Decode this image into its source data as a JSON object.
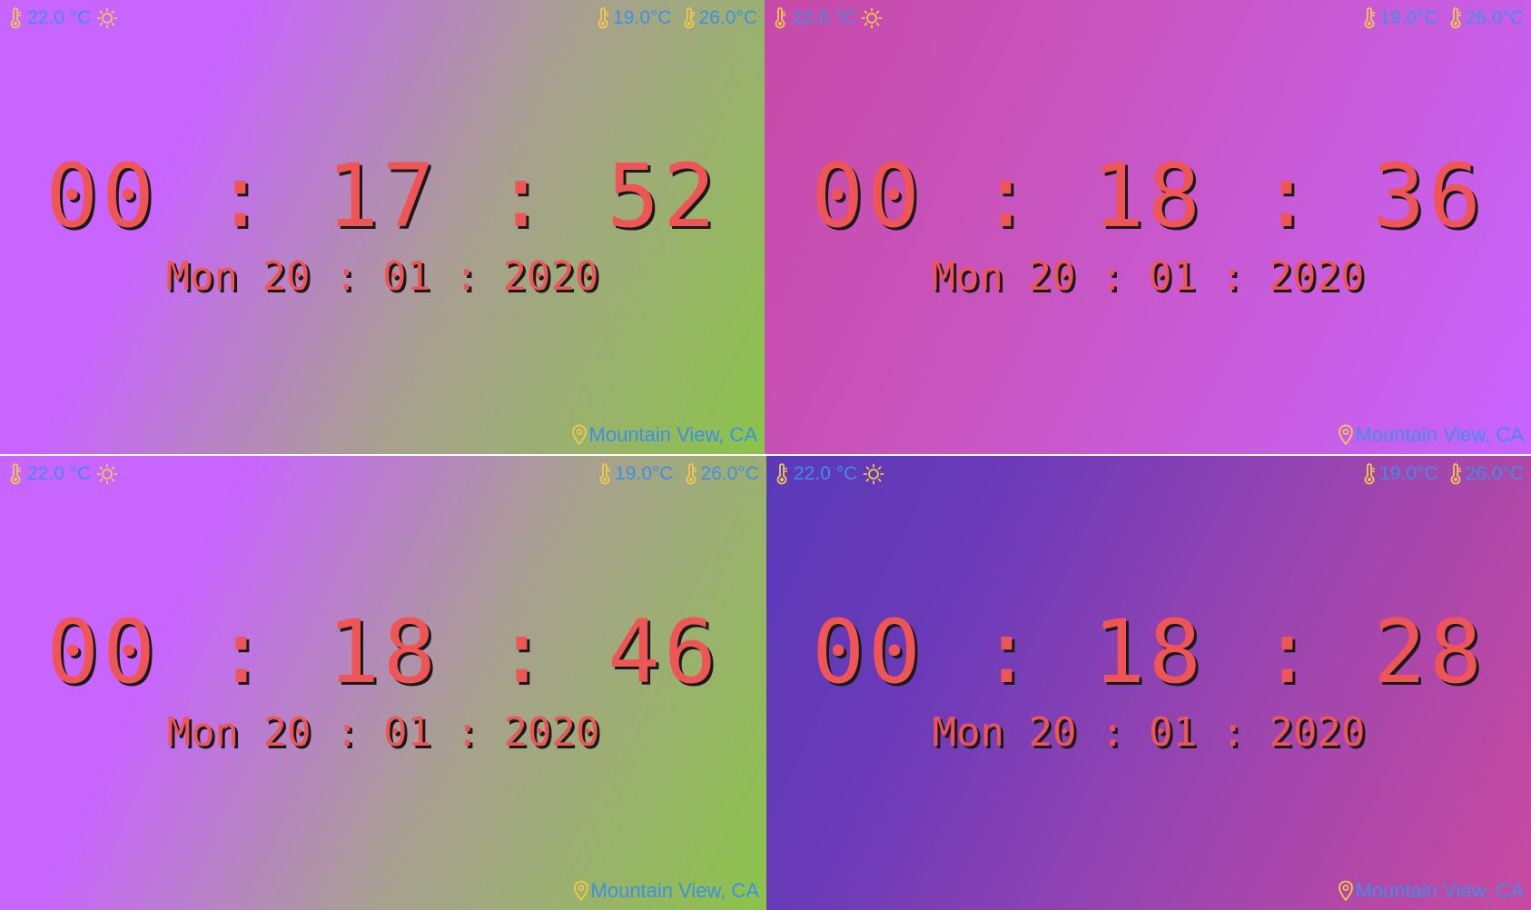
{
  "colors": {
    "time_text": "#f05555",
    "time_shadow": "#1a1a1a",
    "info_text": "#3d8fe8",
    "icon_yellow": "#f2c94c"
  },
  "panels": [
    {
      "background": "linear-gradient(115deg, #c864ff 0%, #c864ff 25%, #a8a090 60%, #8bc34a 100%)",
      "current_temp": "22.0 °C",
      "weather_icon": "sun-icon",
      "min_temp": "19.0°C",
      "max_temp": "26.0°C",
      "time": "00 : 17 : 52",
      "date": "Mon 20 : 01 : 2020",
      "location": "Mountain View, CA"
    },
    {
      "background": "linear-gradient(115deg, #c64aa8 0%, #c855c0 40%, #c864ff 100%)",
      "current_temp": "22.0 °C",
      "weather_icon": "sun-icon",
      "min_temp": "19.0°C",
      "max_temp": "26.0°C",
      "time": "00 : 18 : 36",
      "date": "Mon 20 : 01 : 2020",
      "location": "Mountain View, CA"
    },
    {
      "background": "linear-gradient(115deg, #c864ff 0%, #c864ff 25%, #a8a090 60%, #8bc34a 100%)",
      "current_temp": "22.0 °C",
      "weather_icon": "sun-icon",
      "min_temp": "19.0°C",
      "max_temp": "26.0°C",
      "time": "00 : 18 : 46",
      "date": "Mon 20 : 01 : 2020",
      "location": "Mountain View, CA"
    },
    {
      "background": "linear-gradient(115deg, #5a3ab8 0%, #6a3ab8 25%, #9a45b0 60%, #c84aa0 100%)",
      "current_temp": "22.0 °C",
      "weather_icon": "sun-icon",
      "min_temp": "19.0°C",
      "max_temp": "26.0°C",
      "time": "00 : 18 : 28",
      "date": "Mon 20 : 01 : 2020",
      "location": "Mountain View, CA"
    }
  ]
}
